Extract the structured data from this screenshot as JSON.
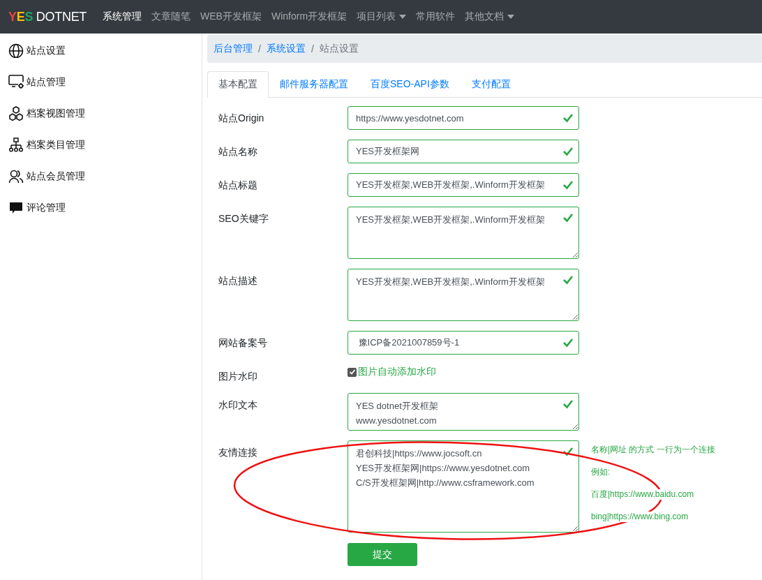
{
  "navbar": {
    "logo": [
      {
        "text": "Y",
        "color": "#e8453c"
      },
      {
        "text": "E",
        "color": "#f4c20d"
      },
      {
        "text": "S",
        "color": "#1fa463"
      },
      {
        "text": " DOTNET",
        "color": "#ffffff"
      }
    ],
    "items": [
      {
        "label": "系统管理",
        "selected": true,
        "dropdown": false
      },
      {
        "label": "文章随笔",
        "selected": false,
        "dropdown": false
      },
      {
        "label": "WEB开发框架",
        "selected": false,
        "dropdown": false
      },
      {
        "label": "Winform开发框架",
        "selected": false,
        "dropdown": false
      },
      {
        "label": "项目列表",
        "selected": false,
        "dropdown": true
      },
      {
        "label": "常用软件",
        "selected": false,
        "dropdown": false
      },
      {
        "label": "其他文档",
        "selected": false,
        "dropdown": true
      }
    ]
  },
  "sidebar": {
    "items": [
      {
        "label": "站点设置"
      },
      {
        "label": "站点管理"
      },
      {
        "label": "档案视图管理"
      },
      {
        "label": "档案类目管理"
      },
      {
        "label": "站点会员管理"
      },
      {
        "label": "评论管理"
      }
    ]
  },
  "breadcrumb": [
    {
      "kind": "link",
      "label": "后台管理"
    },
    {
      "kind": "separator",
      "label": "/"
    },
    {
      "kind": "link",
      "label": "系统设置"
    },
    {
      "kind": "separator",
      "label": "/"
    },
    {
      "kind": "current",
      "label": "站点设置"
    }
  ],
  "tabs": [
    {
      "label": "基本配置",
      "selected": true
    },
    {
      "label": "邮件服务器配置",
      "selected": false
    },
    {
      "label": "百度SEO-API参数",
      "selected": false
    },
    {
      "label": "支付配置",
      "selected": false
    }
  ],
  "form": {
    "fields": [
      {
        "kind": "input",
        "label": "站点Origin",
        "value": "https://www.yesdotnet.com",
        "valid": true
      },
      {
        "kind": "input",
        "label": "站点名称",
        "value": "YES开发框架网",
        "valid": true
      },
      {
        "kind": "input",
        "label": "站点标题",
        "value": "YES开发框架,WEB开发框架,.Winform开发框架",
        "valid": true
      },
      {
        "kind": "textarea",
        "label": "SEO关键字",
        "value": "YES开发框架,WEB开发框架,.Winform开发框架",
        "valid": true
      },
      {
        "kind": "textarea",
        "label": "站点描述",
        "value": "YES开发框架,WEB开发框架,.Winform开发框架",
        "valid": true
      },
      {
        "kind": "input",
        "label": "网站备案号",
        "value": " 豫ICP备2021007859号-1",
        "valid": true
      },
      {
        "kind": "checkbox",
        "label": "图片水印",
        "value": "图片自动添加水印",
        "checked": true
      },
      {
        "kind": "textarea",
        "label": "水印文本",
        "value": "YES dotnet开发框架\nwww.yesdotnet.com",
        "valid": true
      },
      {
        "kind": "textarea",
        "label": "友情连接",
        "value": "君创科技|https://www.jocsoft.cn\nYES开发框架网|https://www.yesdotnet.com\nC/S开发框架网|http://www.csframework.com",
        "valid": true,
        "help": [
          "名称|网址 的方式 一行为一个连接",
          "例如:",
          "百度|https://www.baidu.com",
          "bing|https://www.bing.com"
        ]
      }
    ],
    "submit": "提交"
  }
}
